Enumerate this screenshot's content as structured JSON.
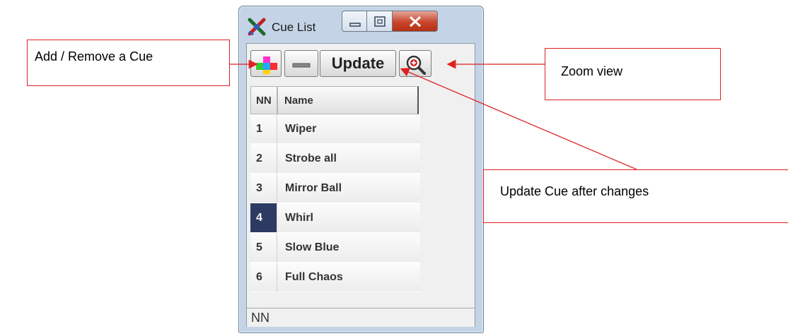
{
  "window": {
    "title": "Cue List",
    "icon": "crossed-tools-icon",
    "controls": [
      "minimize-icon",
      "maximize-icon",
      "close-icon"
    ]
  },
  "toolbar": {
    "add_icon": "colored-plus-icon",
    "remove_icon": "minus-icon",
    "update_label": "Update",
    "zoom_icon": "zoom-in-icon"
  },
  "table": {
    "columns": [
      "NN",
      "Name"
    ],
    "rows": [
      {
        "nn": "1",
        "name": "Wiper"
      },
      {
        "nn": "2",
        "name": "Strobe all"
      },
      {
        "nn": "3",
        "name": "Mirror Ball"
      },
      {
        "nn": "4",
        "name": "Whirl"
      },
      {
        "nn": "5",
        "name": "Slow Blue"
      },
      {
        "nn": "6",
        "name": "Full Chaos"
      }
    ],
    "selected_nn": "4"
  },
  "status": {
    "text": "NN"
  },
  "annotations": {
    "add_remove": "Add / Remove a Cue",
    "zoom": "Zoom view",
    "update": "Update Cue after changes",
    "color": "#e02020"
  }
}
